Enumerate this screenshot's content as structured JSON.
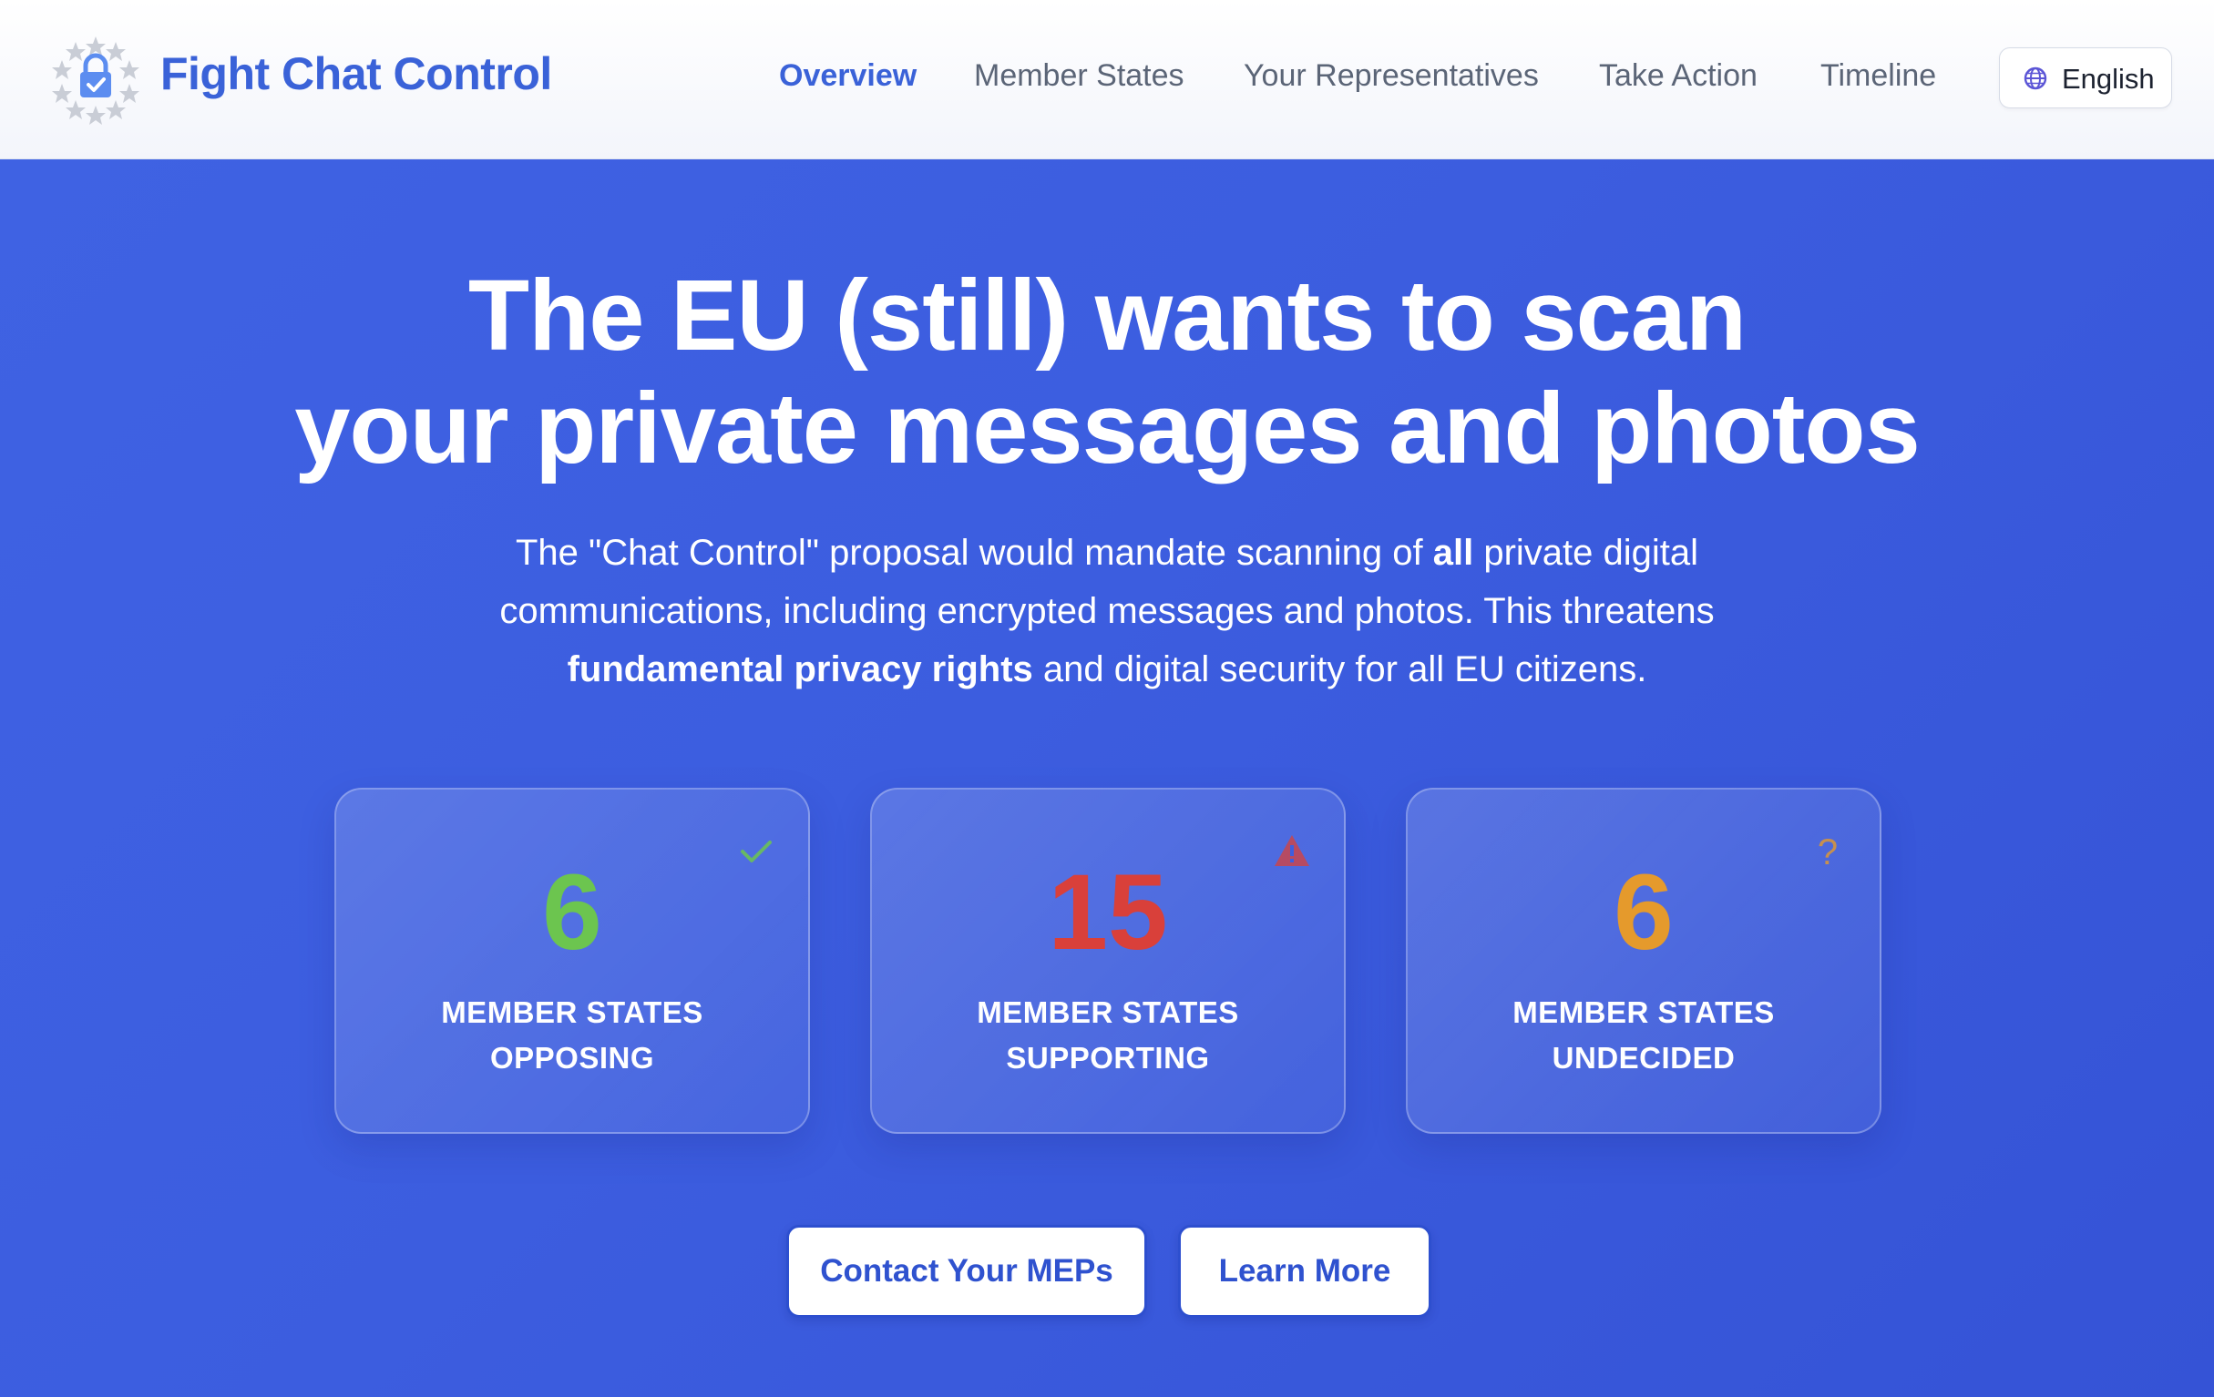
{
  "header": {
    "brand": "Fight Chat Control",
    "nav": [
      {
        "label": "Overview",
        "active": true
      },
      {
        "label": "Member States",
        "active": false
      },
      {
        "label": "Your Representatives",
        "active": false
      },
      {
        "label": "Take Action",
        "active": false
      },
      {
        "label": "Timeline",
        "active": false
      }
    ],
    "language": {
      "label": "English",
      "icon": "globe-icon"
    }
  },
  "hero": {
    "headline_line1": "The EU (still) wants to scan",
    "headline_line2": "your private messages and photos",
    "subtext": {
      "part1": "The \"Chat Control\" proposal would mandate scanning of ",
      "bold1": "all",
      "part2": " private digital communications, including encrypted messages and photos. This threatens ",
      "bold2": "fundamental privacy rights",
      "part3": " and digital security for all EU citizens."
    },
    "stats": [
      {
        "value": "6",
        "label_line1": "MEMBER STATES",
        "label_line2": "OPPOSING",
        "color": "#6cc54f",
        "icon": "check-icon"
      },
      {
        "value": "15",
        "label_line1": "MEMBER STATES",
        "label_line2": "SUPPORTING",
        "color": "#d9403a",
        "icon": "warning-icon"
      },
      {
        "value": "6",
        "label_line1": "MEMBER STATES",
        "label_line2": "UNDECIDED",
        "color": "#e59a2c",
        "icon": "question-icon"
      }
    ],
    "buttons": {
      "contact": "Contact Your MEPs",
      "learn": "Learn More"
    }
  },
  "colors": {
    "accent": "#3a62d8",
    "hero_bg": "#3c5ddf",
    "opposing": "#6cc54f",
    "supporting": "#d9403a",
    "undecided": "#e59a2c"
  }
}
